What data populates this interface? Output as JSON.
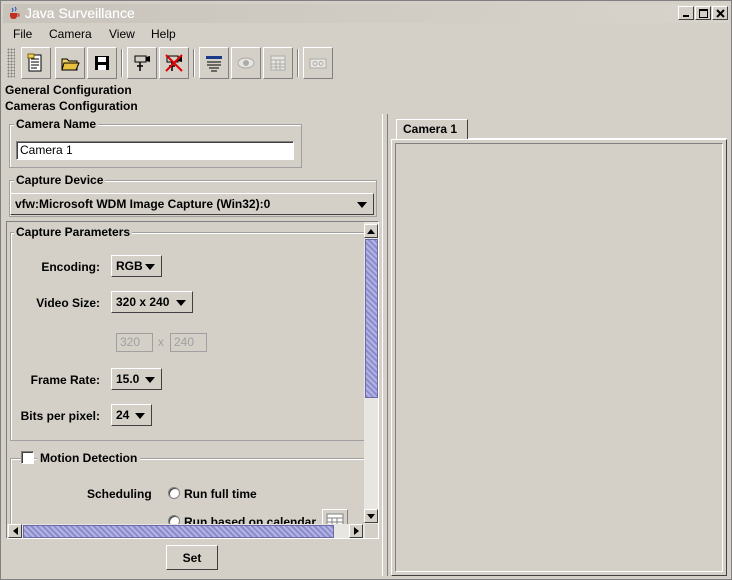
{
  "window": {
    "title": "Java Surveillance"
  },
  "menu": [
    "File",
    "Camera",
    "View",
    "Help"
  ],
  "toolbar": {
    "tools": [
      {
        "icon": "new-document-icon",
        "enabled": true
      },
      {
        "icon": "open-folder-icon",
        "enabled": true
      },
      {
        "icon": "save-disk-icon",
        "enabled": true
      },
      {
        "icon": "add-camera-icon",
        "enabled": true
      },
      {
        "icon": "remove-camera-icon",
        "enabled": true
      },
      {
        "icon": "properties-icon",
        "enabled": true
      },
      {
        "icon": "view-eye-icon",
        "enabled": false
      },
      {
        "icon": "calendar-grid-icon",
        "enabled": false
      },
      {
        "icon": "record-tape-icon",
        "enabled": false
      }
    ]
  },
  "sections": {
    "general": "General Configuration",
    "cameras": "Cameras Configuration"
  },
  "camera_name": {
    "label": "Camera Name",
    "value": "Camera 1"
  },
  "capture_device": {
    "label": "Capture Device",
    "selected": "vfw:Microsoft WDM Image Capture (Win32):0"
  },
  "capture_params": {
    "label": "Capture Parameters",
    "encoding": {
      "label": "Encoding:",
      "value": "RGB"
    },
    "video_size": {
      "label": "Video Size:",
      "value": "320 x 240"
    },
    "width": "320",
    "height": "240",
    "times": "x",
    "frame_rate": {
      "label": "Frame Rate:",
      "value": "15.0"
    },
    "bits": {
      "label": "Bits per pixel:",
      "value": "24"
    }
  },
  "motion": {
    "label": "Motion Detection",
    "checked": false,
    "scheduling_label": "Scheduling",
    "options": [
      "Run full time",
      "Run based on calendar"
    ]
  },
  "set_button": "Set",
  "tabs": [
    "Camera 1"
  ]
}
